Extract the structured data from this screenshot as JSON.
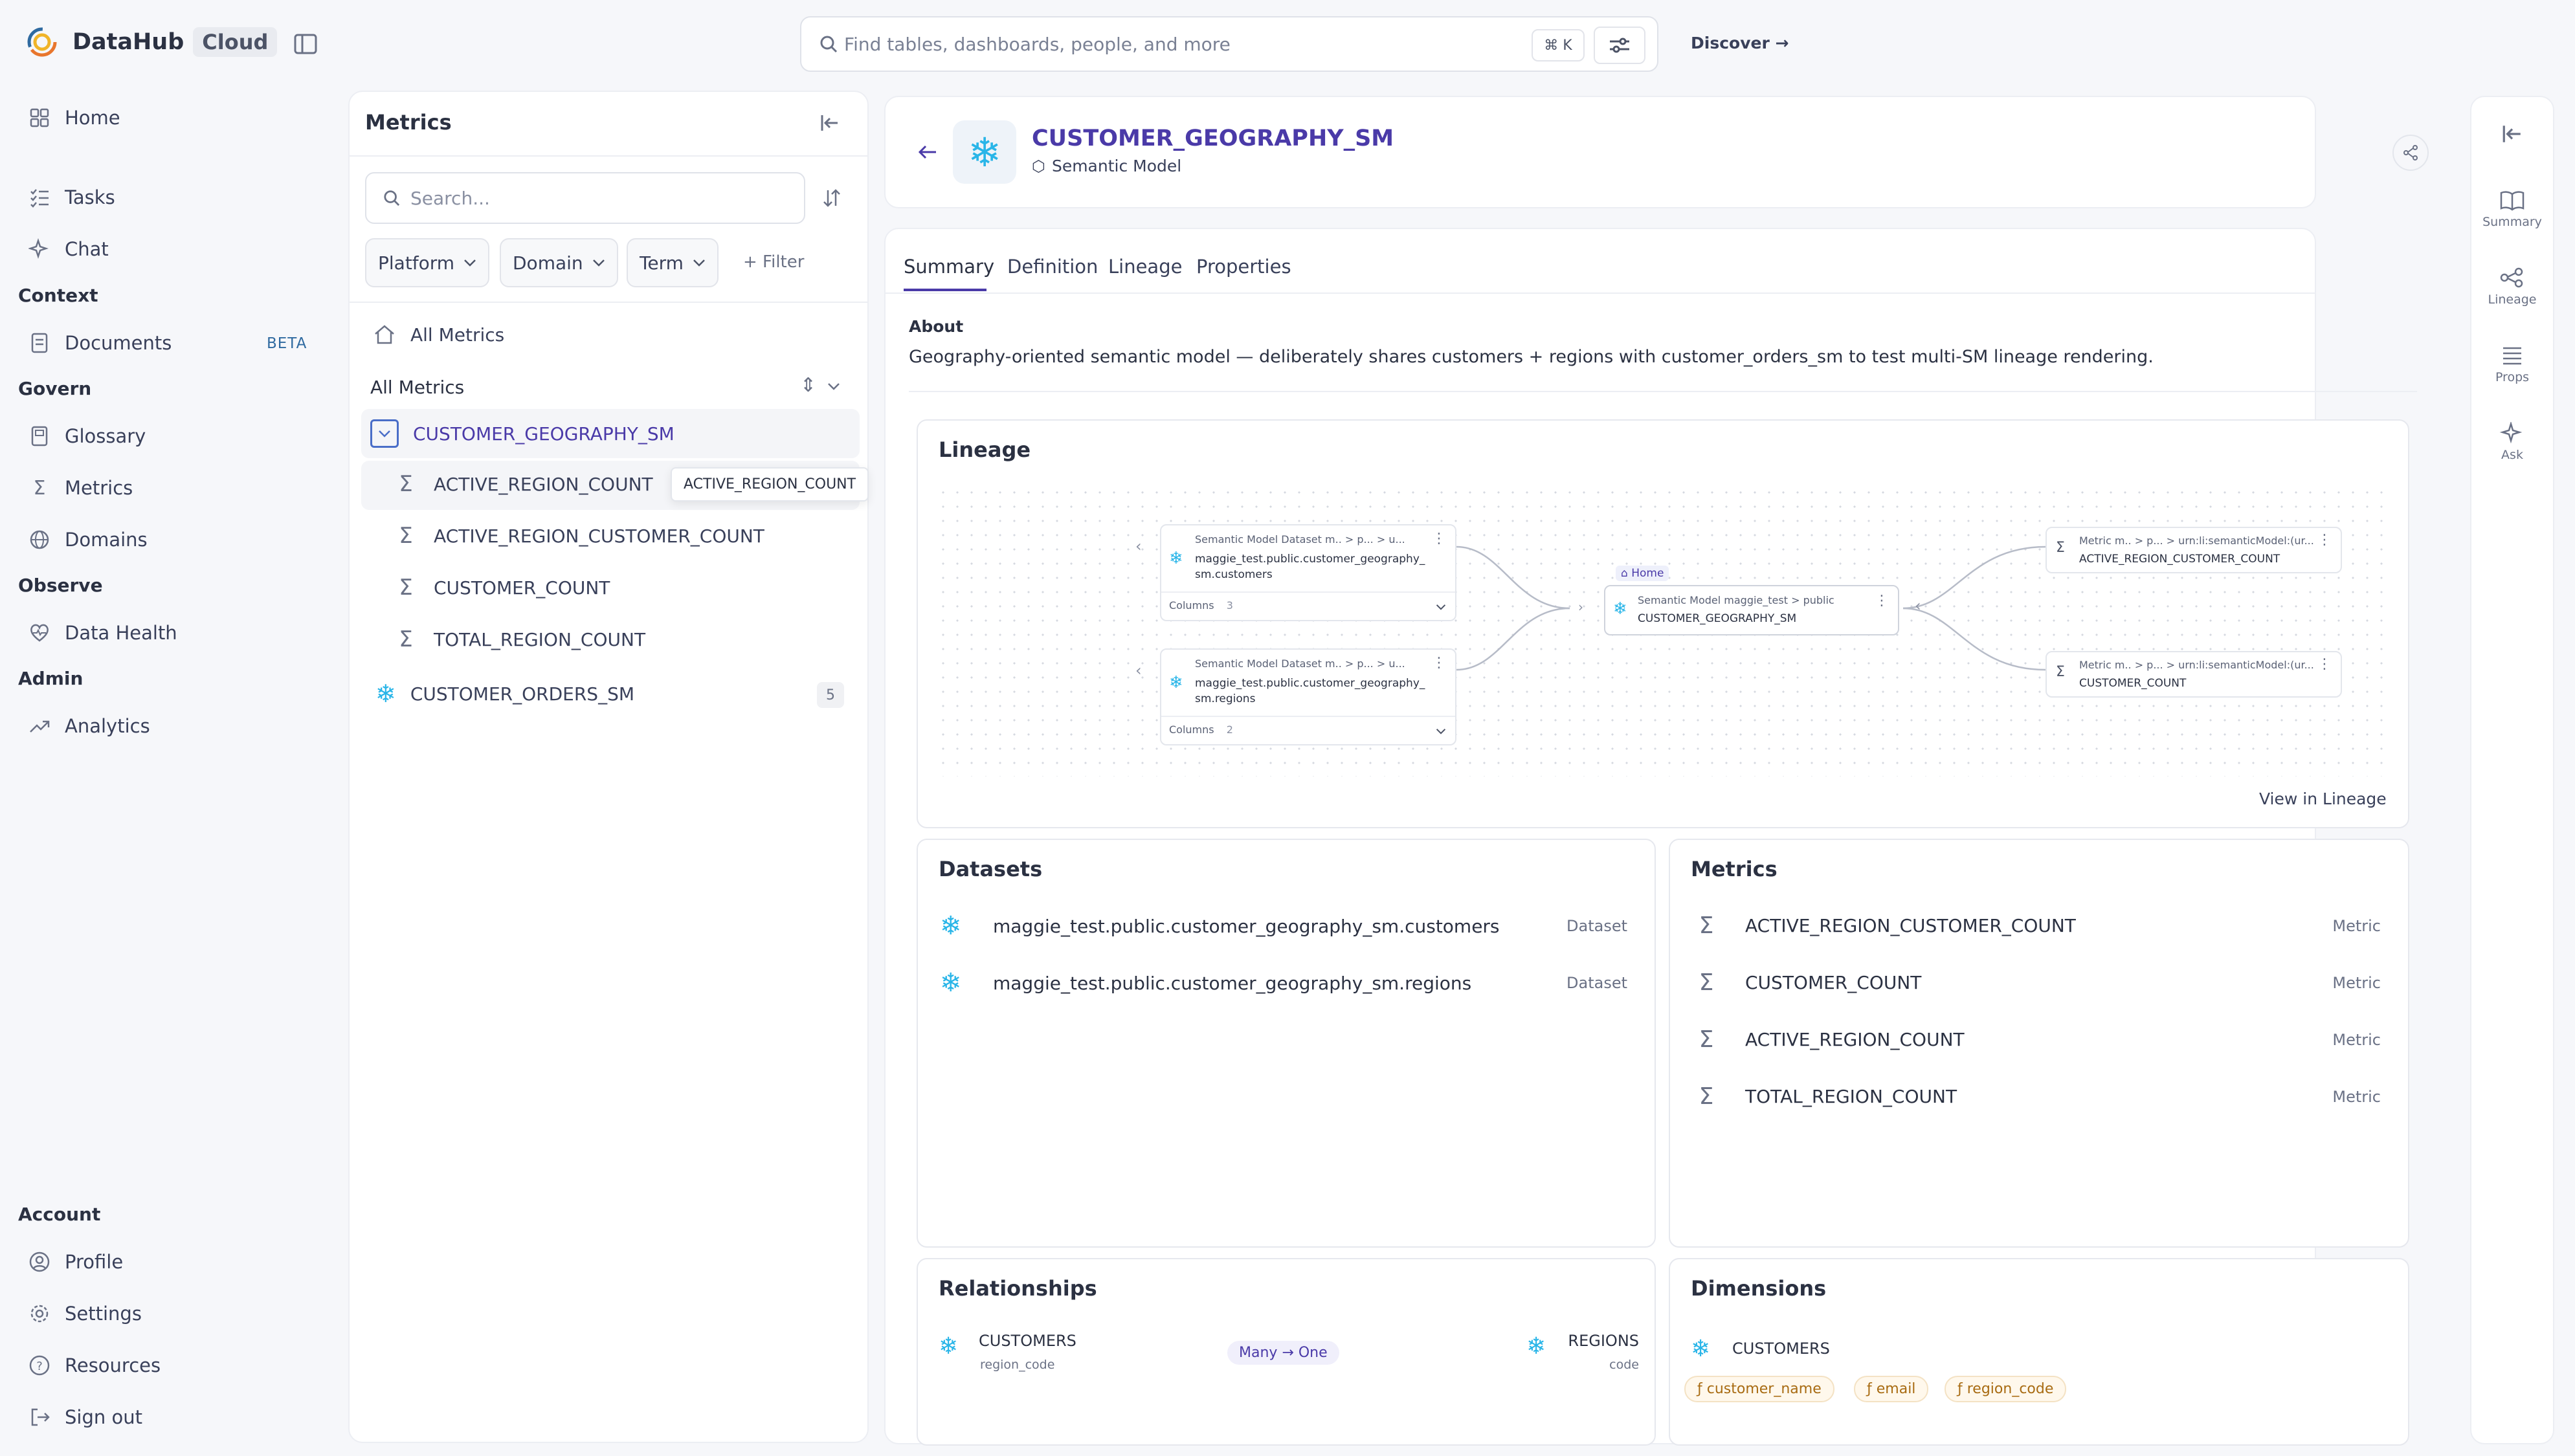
{
  "app": {
    "name": "DataHub",
    "edition": "Cloud"
  },
  "search": {
    "placeholder": "Find tables, dashboards, people, and more",
    "shortcut": "⌘ K",
    "discover": "Discover →"
  },
  "nav": {
    "home": "Home",
    "tasks": "Tasks",
    "chat": "Chat",
    "context": "Context",
    "documents": "Documents",
    "beta": "BETA",
    "govern": "Govern",
    "glossary": "Glossary",
    "metrics": "Metrics",
    "domains": "Domains",
    "observe": "Observe",
    "data_health": "Data Health",
    "admin": "Admin",
    "analytics": "Analytics",
    "account": "Account",
    "profile": "Profile",
    "settings": "Settings",
    "resources": "Resources",
    "sign_out": "Sign out"
  },
  "browser": {
    "title": "Metrics",
    "search_placeholder": "Search...",
    "filters": [
      "Platform",
      "Domain",
      "Term"
    ],
    "add_filter": "+ Filter",
    "all_metrics_link": "All Metrics",
    "all_metrics_header": "All Metrics",
    "selected_model": "CUSTOMER_GEOGRAPHY_SM",
    "children": [
      "ACTIVE_REGION_COUNT",
      "ACTIVE_REGION_CUSTOMER_COUNT",
      "CUSTOMER_COUNT",
      "TOTAL_REGION_COUNT"
    ],
    "tooltip": "ACTIVE_REGION_COUNT",
    "other_model": "CUSTOMER_ORDERS_SM",
    "other_count": "5"
  },
  "entity": {
    "name": "CUSTOMER_GEOGRAPHY_SM",
    "type": "Semantic Model"
  },
  "tabs": [
    "Summary",
    "Definition",
    "Lineage",
    "Properties"
  ],
  "about": {
    "label": "About",
    "text": "Geography-oriented semantic model — deliberately shares customers + regions with customer_orders_sm to test multi-SM lineage rendering."
  },
  "lineage": {
    "title": "Lineage",
    "view_link": "View in Lineage",
    "upstream": [
      {
        "type": "Semantic Model Dataset",
        "path": "m.. > p... > u...",
        "name1": "maggie_test.public.customer_geography_",
        "name2": "sm.customers",
        "columns_label": "Columns",
        "columns": "3"
      },
      {
        "type": "Semantic Model Dataset",
        "path": "m.. > p... > u...",
        "name1": "maggie_test.public.customer_geography_",
        "name2": "sm.regions",
        "columns_label": "Columns",
        "columns": "2"
      }
    ],
    "center": {
      "badge": "Home",
      "type": "Semantic Model",
      "path": "maggie_test > public",
      "name": "CUSTOMER_GEOGRAPHY_SM"
    },
    "downstream": [
      {
        "type": "Metric",
        "path": "m.. > p... > urn:li:semanticModel:(ur...",
        "name": "ACTIVE_REGION_CUSTOMER_COUNT"
      },
      {
        "type": "Metric",
        "path": "m.. > p... > urn:li:semanticModel:(ur...",
        "name": "CUSTOMER_COUNT"
      }
    ]
  },
  "datasets": {
    "title": "Datasets",
    "items": [
      {
        "name": "maggie_test.public.customer_geography_sm.customers",
        "type": "Dataset"
      },
      {
        "name": "maggie_test.public.customer_geography_sm.regions",
        "type": "Dataset"
      }
    ]
  },
  "metrics": {
    "title": "Metrics",
    "items": [
      {
        "name": "ACTIVE_REGION_CUSTOMER_COUNT",
        "type": "Metric"
      },
      {
        "name": "CUSTOMER_COUNT",
        "type": "Metric"
      },
      {
        "name": "ACTIVE_REGION_COUNT",
        "type": "Metric"
      },
      {
        "name": "TOTAL_REGION_COUNT",
        "type": "Metric"
      }
    ]
  },
  "relationships": {
    "title": "Relationships",
    "left": "CUSTOMERS",
    "left_key": "region_code",
    "cardinality": "Many → One",
    "right": "REGIONS",
    "right_key": "code"
  },
  "dimensions": {
    "title": "Dimensions",
    "entity": "CUSTOMERS",
    "fields": [
      "customer_name",
      "email",
      "region_code"
    ]
  },
  "right_sidebar": [
    "Summary",
    "Lineage",
    "Props",
    "Ask"
  ],
  "colors": {
    "accent": "#4a3aa8",
    "snowflake": "#29b5e8",
    "field": "#a86b12"
  }
}
